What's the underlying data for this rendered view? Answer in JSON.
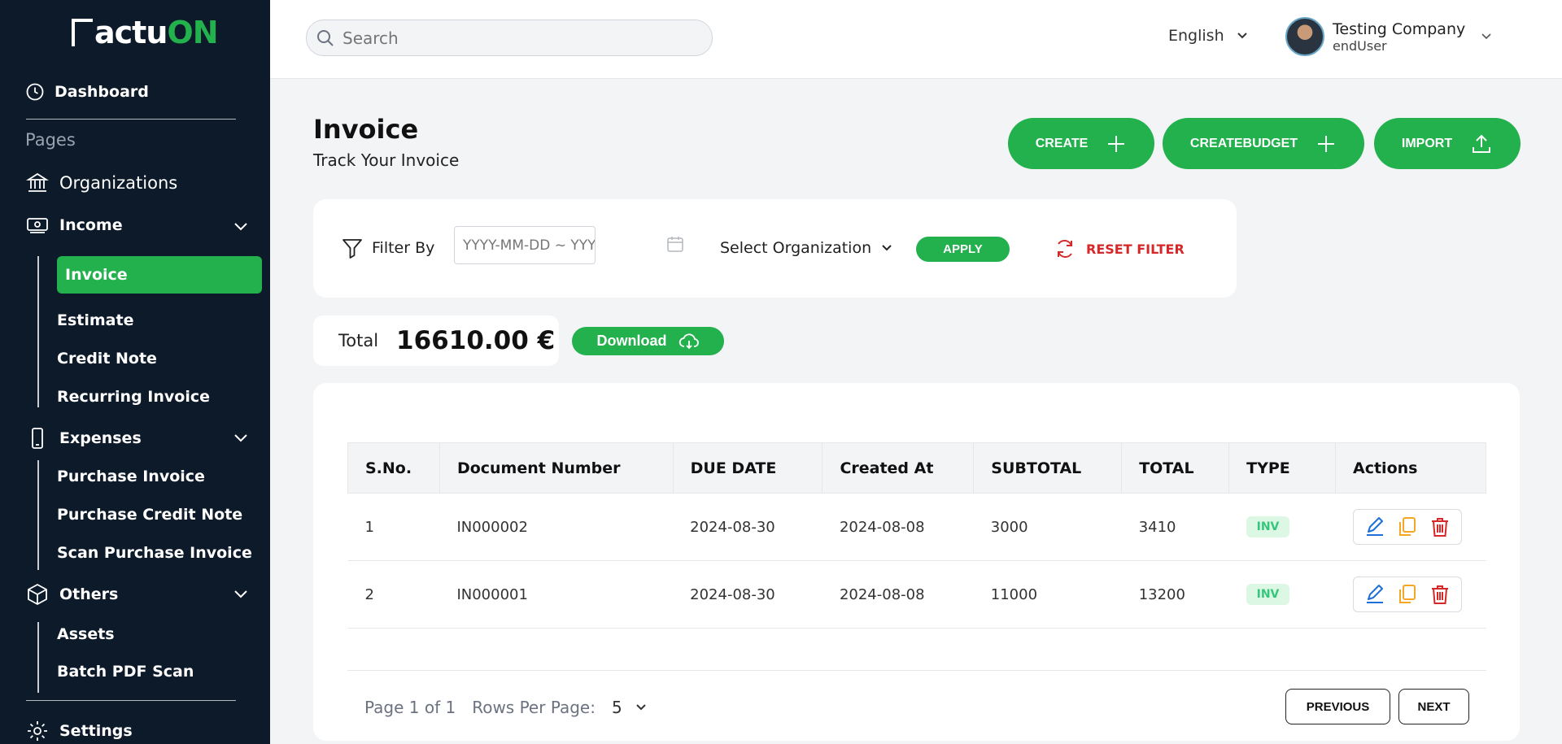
{
  "brand": {
    "logo_prefix": "actu",
    "logo_suffix": "ON"
  },
  "sidebar": {
    "dashboard": "Dashboard",
    "pages_label": "Pages",
    "organizations": "Organizations",
    "income": {
      "label": "Income",
      "items": [
        "Invoice",
        "Estimate",
        "Credit Note",
        "Recurring Invoice"
      ]
    },
    "expenses": {
      "label": "Expenses",
      "items": [
        "Purchase Invoice",
        "Purchase Credit Note",
        "Scan Purchase Invoice"
      ]
    },
    "others": {
      "label": "Others",
      "items": [
        "Assets",
        "Batch PDF Scan"
      ]
    },
    "settings": "Settings"
  },
  "header": {
    "search_placeholder": "Search",
    "language": "English",
    "user_name": "Testing Company",
    "user_role": "endUser"
  },
  "page": {
    "title": "Invoice",
    "subtitle": "Track Your Invoice",
    "buttons": {
      "create": "CREATE",
      "create_budget": "CREATEBUDGET",
      "import": "IMPORT"
    }
  },
  "filter": {
    "label": "Filter By",
    "date_placeholder": "YYYY-MM-DD ~ YYYY-MM-DD",
    "org_select": "Select Organization",
    "apply": "APPLY",
    "reset": "RESET FILTER"
  },
  "summary": {
    "total_label": "Total",
    "total_value": "16610.00 €",
    "download_label": "Download"
  },
  "table": {
    "columns": [
      "S.No.",
      "Document Number",
      "DUE DATE",
      "Created At",
      "SUBTOTAL",
      "TOTAL",
      "TYPE",
      "Actions"
    ],
    "rows": [
      {
        "sno": "1",
        "doc": "IN000002",
        "due": "2024-08-30",
        "created": "2024-08-08",
        "subtotal": "3000",
        "total": "3410",
        "type": "INV"
      },
      {
        "sno": "2",
        "doc": "IN000001",
        "due": "2024-08-30",
        "created": "2024-08-08",
        "subtotal": "11000",
        "total": "13200",
        "type": "INV"
      }
    ]
  },
  "pagination": {
    "page_text": "Page 1 of 1",
    "rows_label": "Rows Per Page:",
    "rows_value": "5",
    "previous": "PREVIOUS",
    "next": "NEXT"
  },
  "colors": {
    "sidebar_bg": "#0c1a2a",
    "accent": "#22b14c",
    "danger": "#d62828",
    "edit": "#1e6fd9",
    "copy": "#f5a623"
  }
}
